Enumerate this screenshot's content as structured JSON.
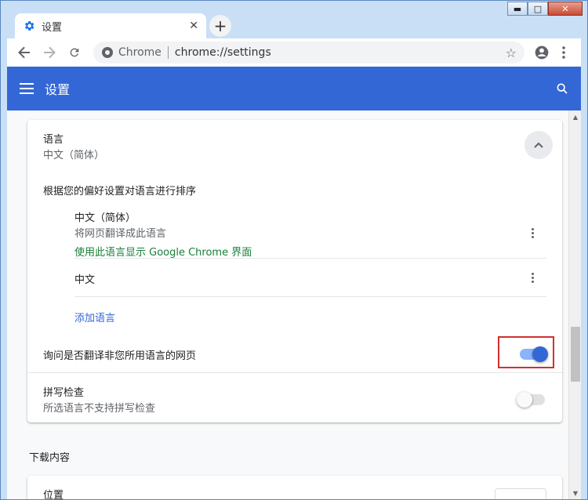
{
  "tab": {
    "title": "设置"
  },
  "toolbar": {
    "site_label": "Chrome",
    "url": "chrome://settings"
  },
  "header": {
    "title": "设置"
  },
  "language": {
    "title": "语言",
    "current": "中文（简体）",
    "order_label": "根据您的偏好设置对语言进行排序",
    "items": [
      {
        "name": "中文（简体）",
        "note": "将网页翻译成此语言",
        "display_link": "使用此语言显示 Google Chrome 界面"
      },
      {
        "name": "中文"
      }
    ],
    "add_language": "添加语言",
    "translate_prompt": {
      "label": "询问是否翻译非您所用语言的网页",
      "enabled": true
    }
  },
  "spellcheck": {
    "title": "拼写检查",
    "subtitle": "所选语言不支持拼写检查",
    "enabled": false
  },
  "downloads": {
    "heading": "下载内容",
    "location_label": "位置"
  },
  "colors": {
    "accent": "#3367d6",
    "highlight": "#d32f2f",
    "link_green": "#188038"
  },
  "icons": [
    "gear-icon",
    "close-icon",
    "plus-icon",
    "back-icon",
    "forward-icon",
    "reload-icon",
    "site-info-icon",
    "star-icon",
    "account-icon",
    "menu-dots-icon",
    "hamburger-icon",
    "search-icon",
    "chevron-up-icon",
    "more-vert-icon"
  ]
}
